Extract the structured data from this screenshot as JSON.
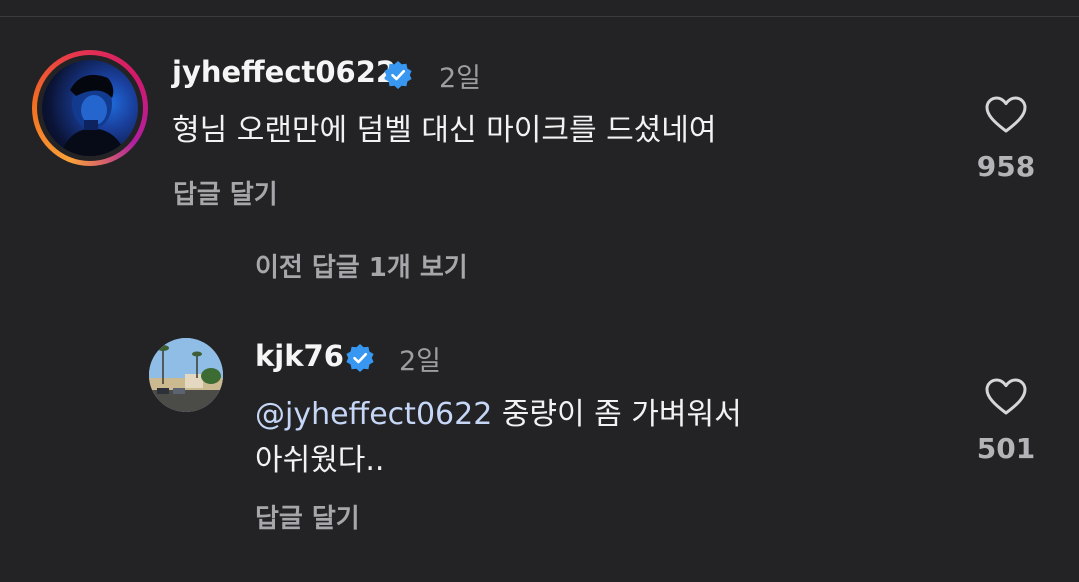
{
  "comment": {
    "username": "jyheffect0622",
    "time": "2일",
    "text": "형님 오랜만에 덤벨 대신 마이크를 드셨네여",
    "reply_label": "답글 달기",
    "likes": "958"
  },
  "view_replies_label": "이전 답글 1개 보기",
  "reply": {
    "username": "kjk76",
    "time": "2일",
    "mention": "@jyheffect0622",
    "text_line1": " 중량이 좀 가벼워서",
    "text_line2": "아쉬웠다..",
    "reply_label": "답글 달기",
    "likes": "501"
  },
  "colors": {
    "background": "#232325",
    "verified_badge": "#3897f0",
    "mention": "#c5d6f7",
    "muted_text": "#a6a6ab"
  },
  "icons": [
    "verified-badge-icon",
    "heart-outline-icon"
  ]
}
